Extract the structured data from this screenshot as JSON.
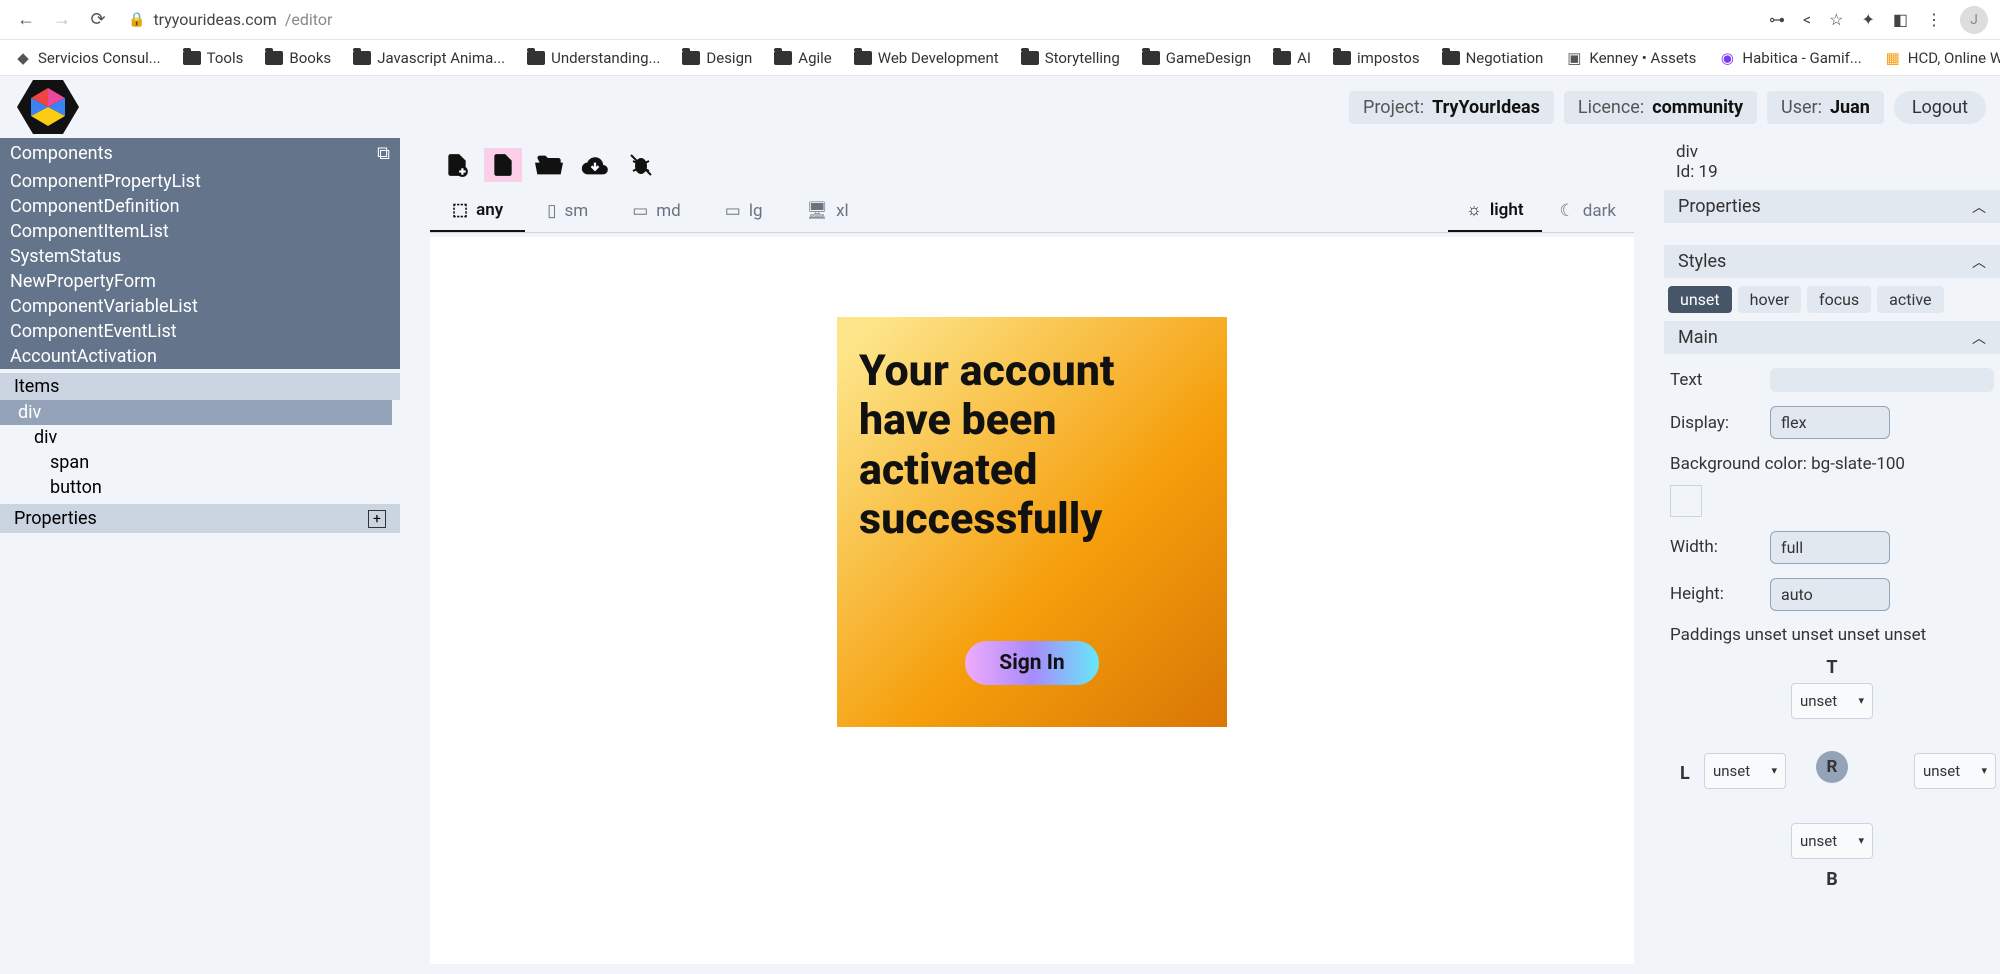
{
  "browser": {
    "url_host": "tryyourideas.com",
    "url_path": "/editor",
    "avatar_letter": "J"
  },
  "bookmarks": [
    {
      "label": "Servicios Consul...",
      "icon": "svc"
    },
    {
      "label": "Tools",
      "icon": "folder"
    },
    {
      "label": "Books",
      "icon": "folder"
    },
    {
      "label": "Javascript Anima...",
      "icon": "folder"
    },
    {
      "label": "Understanding...",
      "icon": "folder"
    },
    {
      "label": "Design",
      "icon": "folder"
    },
    {
      "label": "Agile",
      "icon": "folder"
    },
    {
      "label": "Web Development",
      "icon": "folder"
    },
    {
      "label": "Storytelling",
      "icon": "folder"
    },
    {
      "label": "GameDesign",
      "icon": "folder"
    },
    {
      "label": "AI",
      "icon": "folder"
    },
    {
      "label": "impostos",
      "icon": "folder"
    },
    {
      "label": "Negotiation",
      "icon": "folder"
    },
    {
      "label": "Kenney • Assets",
      "icon": "k"
    },
    {
      "label": "Habitica - Gamif...",
      "icon": "h"
    },
    {
      "label": "HCD, Online Whi...",
      "icon": "m"
    }
  ],
  "header": {
    "project_label": "Project:",
    "project_value": "TryYourIdeas",
    "licence_label": "Licence:",
    "licence_value": "community",
    "user_label": "User:",
    "user_value": "Juan",
    "logout": "Logout"
  },
  "left": {
    "components_title": "Components",
    "components": [
      "ComponentPropertyList",
      "ComponentDefinition",
      "ComponentItemList",
      "SystemStatus",
      "NewPropertyForm",
      "ComponentVariableList",
      "ComponentEventList",
      "AccountActivation"
    ],
    "items_title": "Items",
    "tree": [
      {
        "label": "div",
        "level": 0,
        "selected": true
      },
      {
        "label": "div",
        "level": 1,
        "selected": false
      },
      {
        "label": "span",
        "level": 2,
        "selected": false
      },
      {
        "label": "button",
        "level": 2,
        "selected": false
      }
    ],
    "properties_title": "Properties"
  },
  "breakpoints": [
    {
      "label": "any",
      "active": true
    },
    {
      "label": "sm",
      "active": false
    },
    {
      "label": "md",
      "active": false
    },
    {
      "label": "lg",
      "active": false
    },
    {
      "label": "xl",
      "active": false
    }
  ],
  "themes": [
    {
      "label": "light",
      "active": true
    },
    {
      "label": "dark",
      "active": false
    }
  ],
  "card": {
    "text": "Your account have been activated successfully",
    "button": "Sign In"
  },
  "right": {
    "element_tag": "div",
    "element_id_label": "Id: 19",
    "properties_title": "Properties",
    "styles_title": "Styles",
    "states": [
      "unset",
      "hover",
      "focus",
      "active"
    ],
    "main_title": "Main",
    "text_label": "Text",
    "display_label": "Display:",
    "display_value": "flex",
    "bg_label": "Background color: bg-slate-100",
    "width_label": "Width:",
    "width_value": "full",
    "height_label": "Height:",
    "height_value": "auto",
    "paddings_label": "Paddings unset unset unset unset",
    "pad": {
      "t": "T",
      "l": "L",
      "r": "R",
      "b": "B",
      "center": "R",
      "val": "unset"
    }
  }
}
